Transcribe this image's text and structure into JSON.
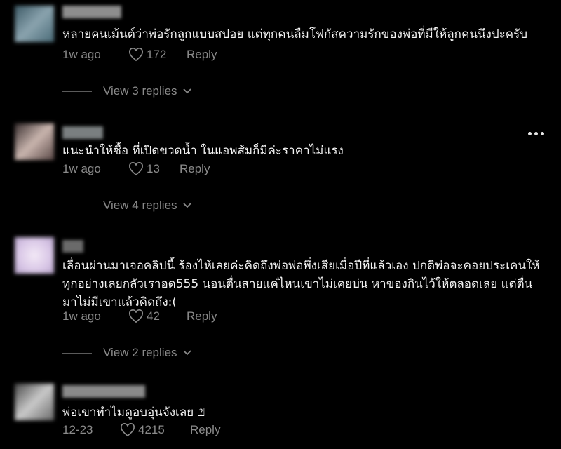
{
  "comments": [
    {
      "text": "หลายคนเม้นต์ว่าพ่อรักลูกแบบสปอย แต่ทุกคนลืมโฟกัสความรักของพ่อที่มีให้ลูกคนนึงปะครับ",
      "time": "1w ago",
      "likes": "172",
      "reply_label": "Reply",
      "view_replies": "View 3 replies",
      "avatar_colors": [
        "#4a6b78",
        "#8aa3ae"
      ],
      "name_color": "#8d8d8d"
    },
    {
      "text": "แนะนำให้ซื้อ ที่เปิดขวดน้ำ ในแอพส้มก็มีค่ะราคาไม่แรง",
      "time": "1w ago",
      "likes": "13",
      "reply_label": "Reply",
      "view_replies": "View 4 replies",
      "avatar_colors": [
        "#5c4a48",
        "#c9b5ae"
      ],
      "name_color": "#7a7f80"
    },
    {
      "text": "เลื่อนผ่านมาเจอคลิปนี้ ร้องไห้เลยค่ะคิดถึงพ่อพ่อพึ่งเสียเมื่อปีที่แล้วเอง ปกติพ่อจะคอยประเคนให้ทุกอย่างเลยกลัวเราอด555 นอนตื่นสายแค่ไหนเขาไม่เคยบ่น หาของกินไว้ให้ตลอดเลย แต่ตื่นมาไม่มีเขาแล้วคิดถึง:(",
      "time": "1w ago",
      "likes": "42",
      "reply_label": "Reply",
      "view_replies": "View 2 replies",
      "avatar_colors": [
        "#d8c6e6",
        "#f3e9f6"
      ],
      "name_color": "#6a6a6a"
    },
    {
      "text": "พ่อเขาทำไมดูอบอุ่นจังเลย ⍰",
      "time": "12-23",
      "likes": "4215",
      "reply_label": "Reply",
      "avatar_colors": [
        "#6a6a6a",
        "#c9c9c9"
      ],
      "name_color": "#8a8a8a"
    }
  ],
  "more_icon": "more-horizontal-icon",
  "like_icon": "heart-outline-icon",
  "colors": {
    "background": "#000000",
    "text": "#f2f2f2",
    "secondary": "#8a8a8a"
  }
}
